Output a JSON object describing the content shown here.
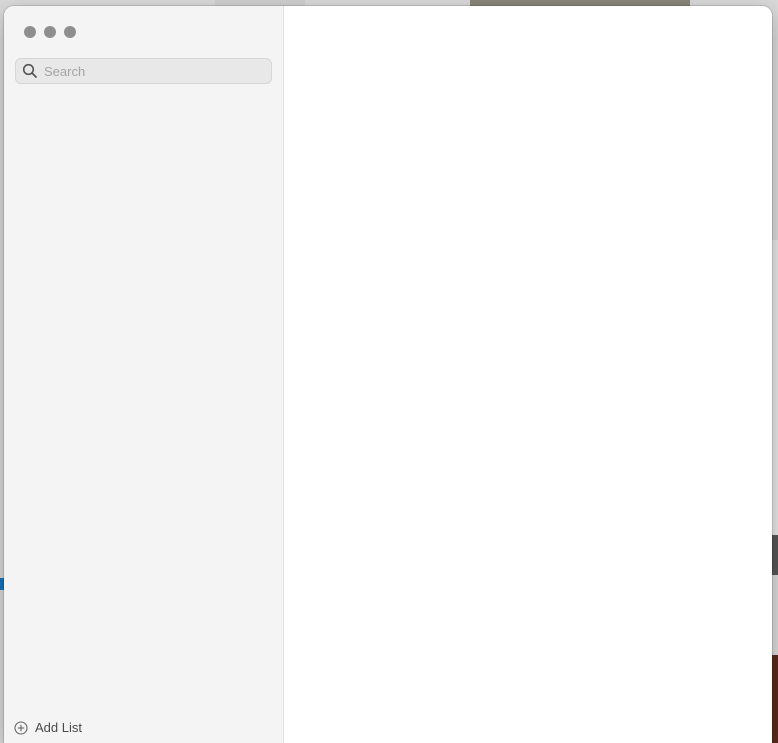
{
  "window": {
    "traffic_lights": [
      "close",
      "minimize",
      "zoom"
    ]
  },
  "sidebar": {
    "search": {
      "placeholder": "Search",
      "value": "",
      "icon": "search-icon"
    },
    "lists": [],
    "add_list": {
      "label": "Add List",
      "icon": "add-circle-icon"
    }
  },
  "main": {
    "items": []
  },
  "colors": {
    "sidebar_bg": "#f4f4f4",
    "main_bg": "#ffffff",
    "traffic_light_inactive": "#8e8e8e"
  }
}
